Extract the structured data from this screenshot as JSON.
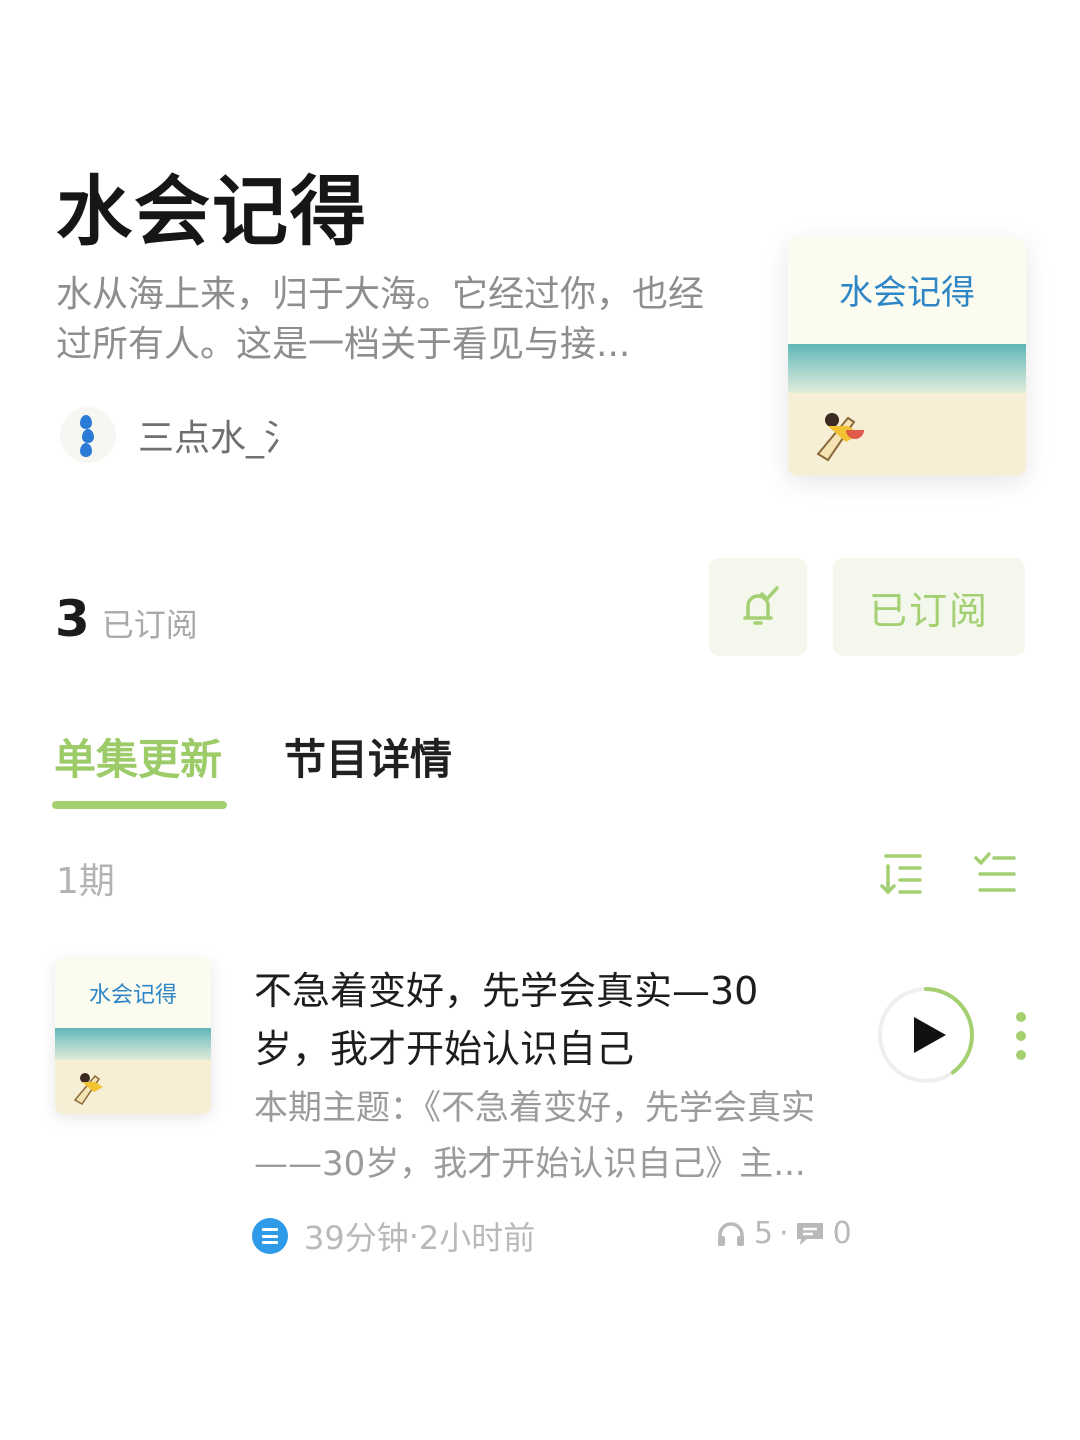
{
  "podcast": {
    "title": "水会记得",
    "description": "水从海上来，归于大海。它经过你，也经过所有人。这是一档关于看见与接...",
    "author_name": "三点水_氵",
    "cover_text": "水会记得"
  },
  "subscription": {
    "count": "3",
    "count_label": "已订阅",
    "subscribe_button": "已订阅",
    "bell_icon": "bell-check-icon"
  },
  "tabs": [
    {
      "label": "单集更新",
      "active": true
    },
    {
      "label": "节目详情",
      "active": false
    }
  ],
  "episodes_header": {
    "count": "1期",
    "sort_icon": "sort-order-icon",
    "filter_icon": "checklist-icon"
  },
  "episode": {
    "title": "不急着变好，先学会真实—30岁，我才开始认识自己",
    "description": "本期主题：《不急着变好，先学会真实——30岁，我才开始认识自己》主...",
    "duration": "39分钟",
    "separator": " · ",
    "published": "2小时前",
    "plays": "5",
    "stats_separator": "·",
    "comments": "0",
    "cover_text": "水会记得",
    "play_progress": 0.4
  },
  "colors": {
    "accent": "#a4d070",
    "accent_bg": "#f3f7ec",
    "list_icon": "#2f9be8",
    "author_dot": "#2b7ad6"
  }
}
